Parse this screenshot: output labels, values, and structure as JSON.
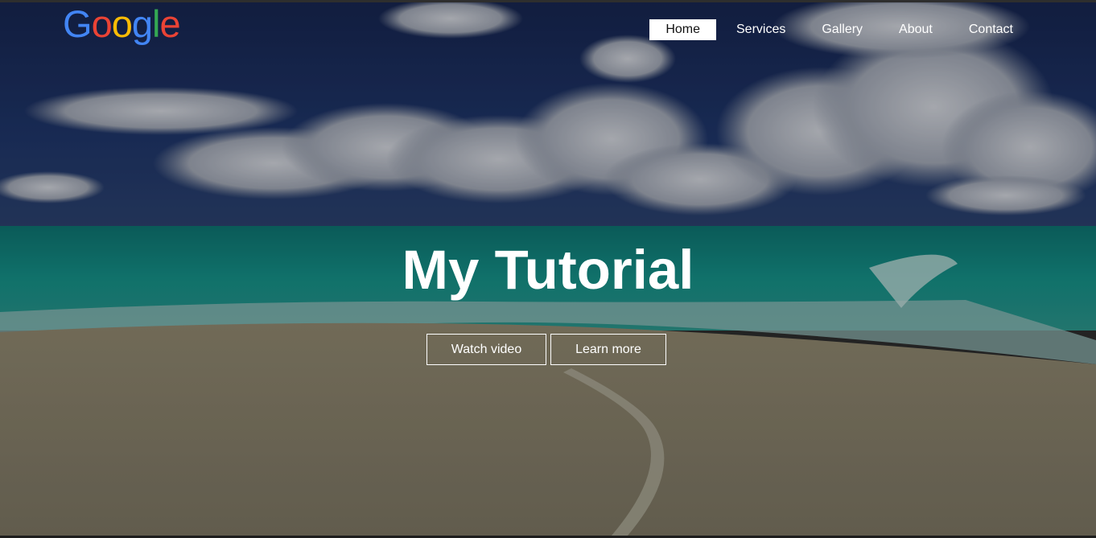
{
  "logo": {
    "letters": [
      {
        "char": "G",
        "color": "#4285F4"
      },
      {
        "char": "o",
        "color": "#EA4335"
      },
      {
        "char": "o",
        "color": "#FBBC05"
      },
      {
        "char": "g",
        "color": "#4285F4"
      },
      {
        "char": "l",
        "color": "#34A853"
      },
      {
        "char": "e",
        "color": "#EA4335"
      }
    ]
  },
  "nav": {
    "items": [
      {
        "label": "Home",
        "active": true
      },
      {
        "label": "Services",
        "active": false
      },
      {
        "label": "Gallery",
        "active": false
      },
      {
        "label": "About",
        "active": false
      },
      {
        "label": "Contact",
        "active": false
      }
    ]
  },
  "hero": {
    "title": "My Tutorial",
    "buttons": {
      "watch_label": "Watch video",
      "learn_label": "Learn more"
    }
  },
  "colors": {
    "sky_top": "#1a2a55",
    "sea": "#0f7d78",
    "sand": "#7a7565",
    "overlay": "rgba(0,0,0,0.45)"
  }
}
